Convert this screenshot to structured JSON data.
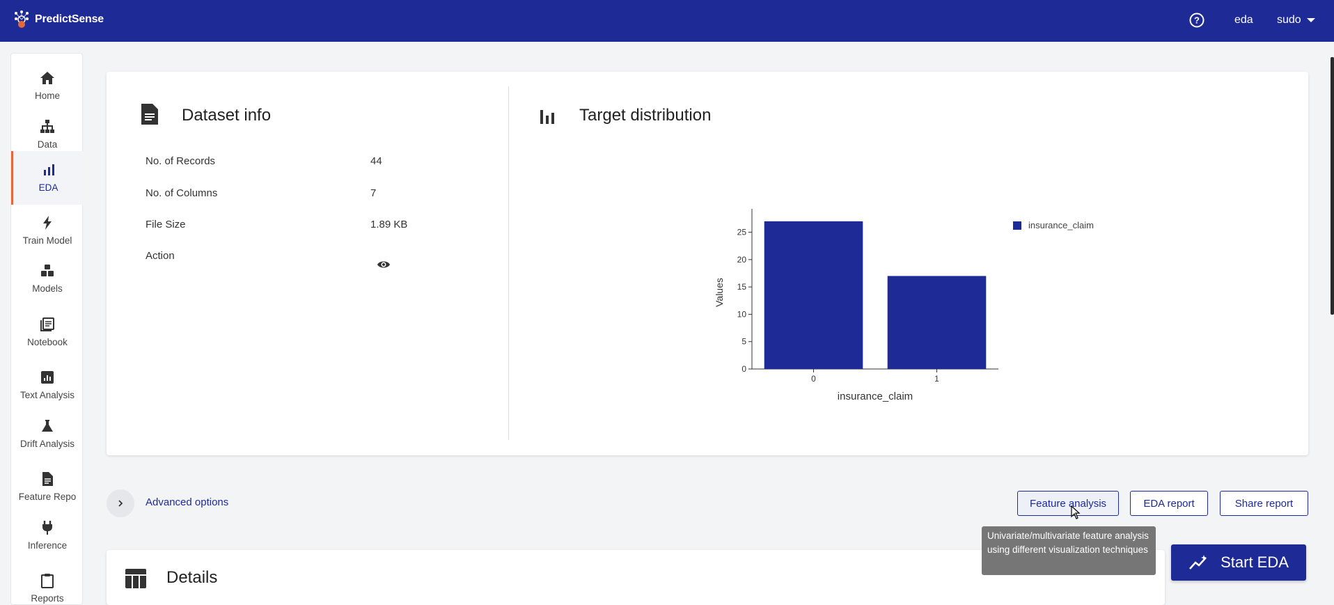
{
  "app": {
    "brand": "PredictSense",
    "user": "eda",
    "role": "sudo"
  },
  "sidebar": {
    "items": [
      {
        "label": "Home",
        "icon": "home-icon"
      },
      {
        "label": "Data",
        "icon": "sitemap-icon"
      },
      {
        "label": "EDA",
        "icon": "bar-chart-icon",
        "active": true
      },
      {
        "label": "Train Model",
        "icon": "bolt-icon"
      },
      {
        "label": "Models",
        "icon": "cubes-icon"
      },
      {
        "label": "Notebook",
        "icon": "notebook-icon"
      },
      {
        "label": "Text Analysis",
        "icon": "text-analysis-icon"
      },
      {
        "label": "Drift Analysis",
        "icon": "flask-icon"
      },
      {
        "label": "Feature Repo",
        "icon": "document-icon"
      },
      {
        "label": "Inference",
        "icon": "plug-icon"
      },
      {
        "label": "Reports",
        "icon": "clipboard-icon"
      }
    ]
  },
  "dataset_info": {
    "title": "Dataset info",
    "rows": [
      {
        "label": "No. of Records",
        "value": "44"
      },
      {
        "label": "No. of Columns",
        "value": "7"
      },
      {
        "label": "File Size",
        "value": "1.89 KB"
      },
      {
        "label": "Action",
        "value": ""
      }
    ]
  },
  "target_distribution": {
    "title": "Target distribution"
  },
  "chart_data": {
    "type": "bar",
    "categories": [
      "0",
      "1"
    ],
    "series": [
      {
        "name": "insurance_claim",
        "values": [
          27,
          17
        ]
      }
    ],
    "xlabel": "insurance_claim",
    "ylabel": "Values",
    "ylim": [
      0,
      28
    ],
    "yticks": [
      0,
      5,
      10,
      15,
      20,
      25
    ],
    "legend": "top-right",
    "color": "#1e2a96"
  },
  "advanced": {
    "label": "Advanced options"
  },
  "actions": {
    "feature_analysis": "Feature analysis",
    "eda_report": "EDA report",
    "share_report": "Share report"
  },
  "tooltip": {
    "text": "Univariate/multivariate feature analysis using different visualization techniques"
  },
  "start": {
    "label": "Start EDA"
  },
  "details": {
    "title": "Details"
  }
}
